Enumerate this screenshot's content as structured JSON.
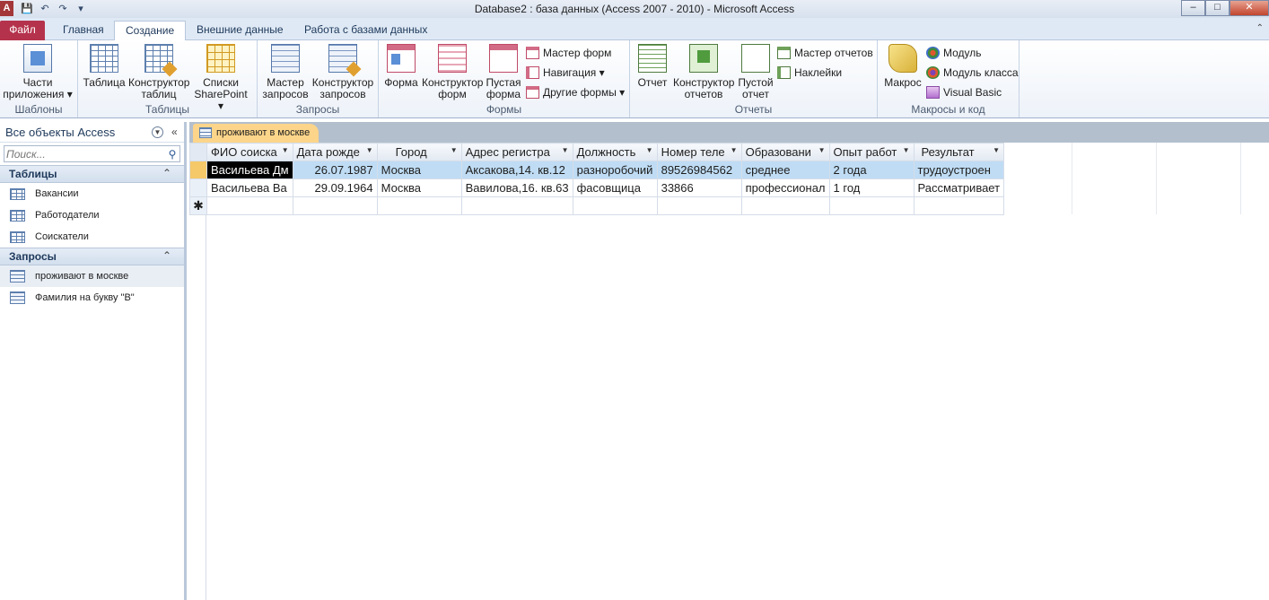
{
  "window": {
    "title": "Database2 : база данных (Access 2007 - 2010)  -  Microsoft Access",
    "app_icon_letter": "A",
    "buttons": {
      "minimize": "–",
      "maximize": "□",
      "close": "✕"
    }
  },
  "quick_access": {
    "save": "💾",
    "undo": "↶",
    "redo": "↷",
    "customize": "▾"
  },
  "ribbon_tabs": {
    "file": "Файл",
    "home": "Главная",
    "create": "Создание",
    "external": "Внешние данные",
    "dbtools": "Работа с базами данных"
  },
  "ribbon": {
    "templates": {
      "label": "Шаблоны",
      "parts": "Части\nприложения ▾"
    },
    "tables": {
      "label": "Таблицы",
      "table": "Таблица",
      "table_design": "Конструктор\nтаблиц",
      "sharepoint": "Списки\nSharePoint ▾"
    },
    "queries": {
      "label": "Запросы",
      "wizard": "Мастер\nзапросов",
      "design": "Конструктор\nзапросов"
    },
    "forms": {
      "label": "Формы",
      "form": "Форма",
      "form_design": "Конструктор\nформ",
      "blank_form": "Пустая\nформа",
      "form_wizard": "Мастер форм",
      "navigation": "Навигация ▾",
      "more_forms": "Другие формы ▾"
    },
    "reports": {
      "label": "Отчеты",
      "report": "Отчет",
      "report_design": "Конструктор\nотчетов",
      "blank_report": "Пустой\nотчет",
      "report_wizard": "Мастер отчетов",
      "labels": "Наклейки"
    },
    "macros": {
      "label": "Макросы и код",
      "macro": "Макрос",
      "module": "Модуль",
      "class_module": "Модуль класса",
      "visual_basic": "Visual Basic"
    }
  },
  "nav": {
    "title": "Все объекты Access",
    "search_placeholder": "Поиск...",
    "groups": [
      {
        "name": "Таблицы",
        "items": [
          "Вакансии",
          "Работодатели",
          "Соискатели"
        ]
      },
      {
        "name": "Запросы",
        "items": [
          "проживают в москве",
          "Фамилия на букву \"В\""
        ]
      }
    ]
  },
  "document": {
    "tab_title": "проживают в москве",
    "columns": [
      "ФИО соиска",
      "Дата рожде",
      "Город",
      "Адрес регистра",
      "Должность",
      "Номер теле",
      "Образовани",
      "Опыт работ",
      "Результат"
    ],
    "rows": [
      [
        "Васильева Дм",
        "26.07.1987",
        "Москва",
        "Аксакова,14. кв.12",
        "разноробочий",
        "89526984562",
        "среднее",
        "2 года",
        "трудоустроен"
      ],
      [
        "Васильева Ва",
        "29.09.1964",
        "Москва",
        "Вавилова,16. кв.63",
        "фасовщица",
        "33866",
        "профессионал",
        "1 год",
        "Рассматривает"
      ]
    ],
    "new_row_marker": "✱"
  }
}
